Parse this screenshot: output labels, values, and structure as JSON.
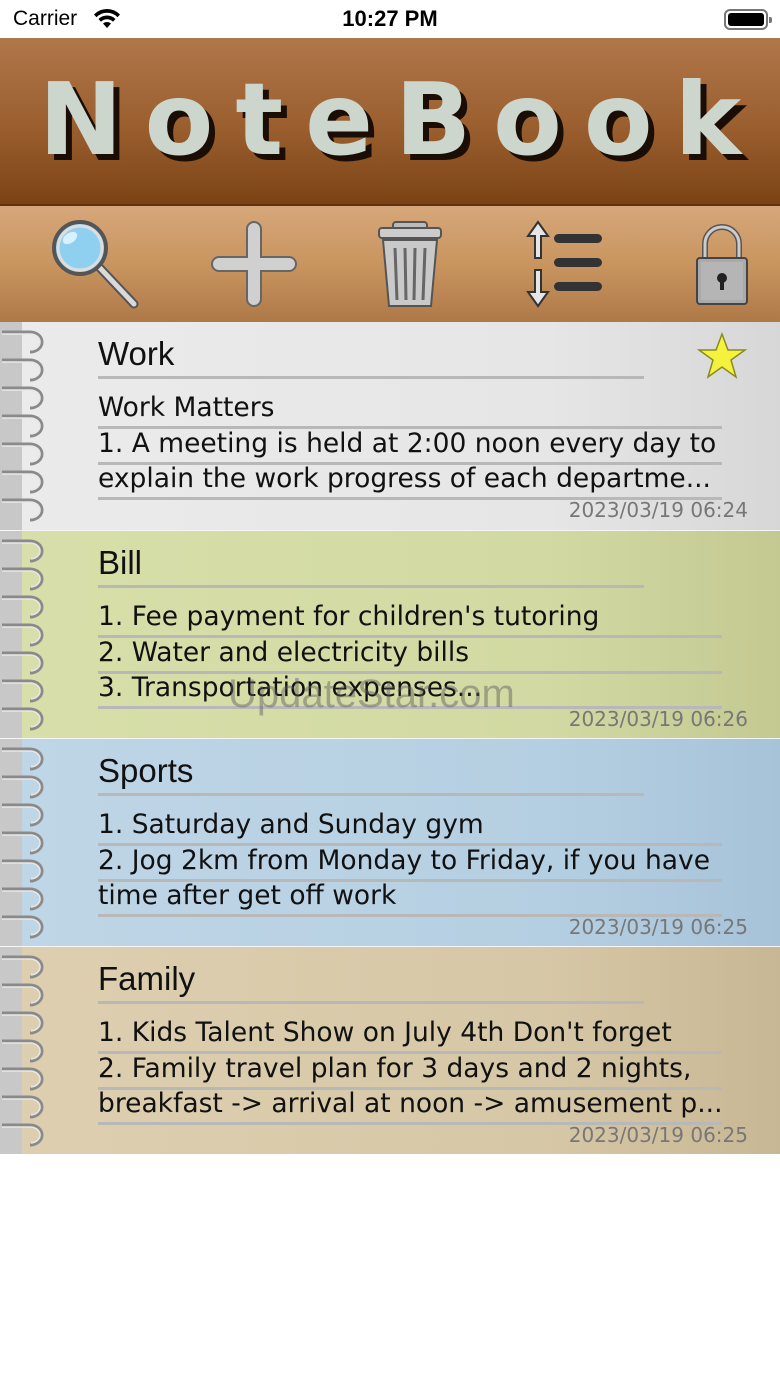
{
  "status_bar": {
    "carrier": "Carrier",
    "time": "10:27 PM"
  },
  "app": {
    "title": "NoteBook"
  },
  "toolbar": {
    "items": [
      {
        "name": "search",
        "icon": "magnifier-icon"
      },
      {
        "name": "add",
        "icon": "plus-icon"
      },
      {
        "name": "delete",
        "icon": "trash-icon"
      },
      {
        "name": "sort",
        "icon": "sort-list-icon"
      },
      {
        "name": "lock",
        "icon": "padlock-icon"
      }
    ]
  },
  "notes": [
    {
      "title": "Work",
      "starred": true,
      "lines": [
        "Work Matters",
        " 1. A meeting is held at 2:00 noon every day to",
        "explain the work progress of each departme..."
      ],
      "date": "2023/03/19 06:24",
      "color": "#e6e6e6"
    },
    {
      "title": "Bill",
      "starred": false,
      "lines": [
        "1. Fee payment for children's tutoring",
        "2. Water and electricity bills",
        "3. Transportation expenses..."
      ],
      "date": "2023/03/19 06:26",
      "color": "#d2d9a2"
    },
    {
      "title": "Sports",
      "starred": false,
      "lines": [
        "1. Saturday and Sunday gym",
        "2. Jog 2km from Monday to Friday, if you have",
        "time after get off work"
      ],
      "date": "2023/03/19 06:25",
      "color": "#b5cfe2"
    },
    {
      "title": "Family",
      "starred": false,
      "lines": [
        " 1. Kids Talent Show on July 4th Don't forget",
        " 2. Family travel plan for 3 days and 2 nights,",
        "breakfast -> arrival at noon -> amusement p..."
      ],
      "date": "2023/03/19 06:25",
      "color": "#d6c7a6"
    }
  ],
  "watermark": "UpdateStar.com"
}
